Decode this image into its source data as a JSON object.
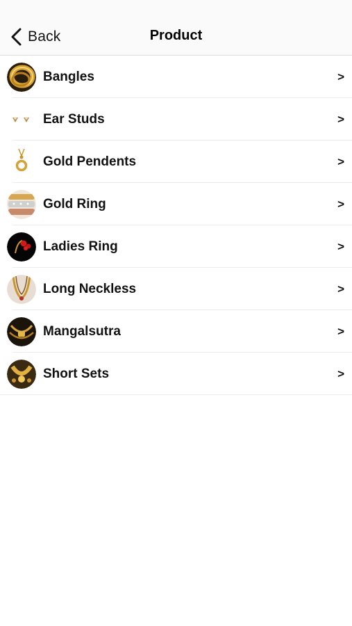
{
  "nav": {
    "back_label": "Back",
    "title": "Product"
  },
  "products": [
    {
      "label": "Bangles",
      "arrow": ">",
      "icon": "bangles-icon"
    },
    {
      "label": "Ear Studs",
      "arrow": ">",
      "icon": "ear-studs-icon"
    },
    {
      "label": "Gold Pendents",
      "arrow": ">",
      "icon": "gold-pendant-icon"
    },
    {
      "label": "Gold Ring",
      "arrow": ">",
      "icon": "gold-ring-icon"
    },
    {
      "label": "Ladies Ring",
      "arrow": ">",
      "icon": "ladies-ring-icon"
    },
    {
      "label": "Long Neckless",
      "arrow": ">",
      "icon": "long-necklace-icon"
    },
    {
      "label": "Mangalsutra",
      "arrow": ">",
      "icon": "mangalsutra-icon"
    },
    {
      "label": "Short Sets",
      "arrow": ">",
      "icon": "short-sets-icon"
    }
  ],
  "colors": {
    "gold": "#c9962a",
    "nav_background": "#fafafa",
    "separator": "#ececec"
  }
}
